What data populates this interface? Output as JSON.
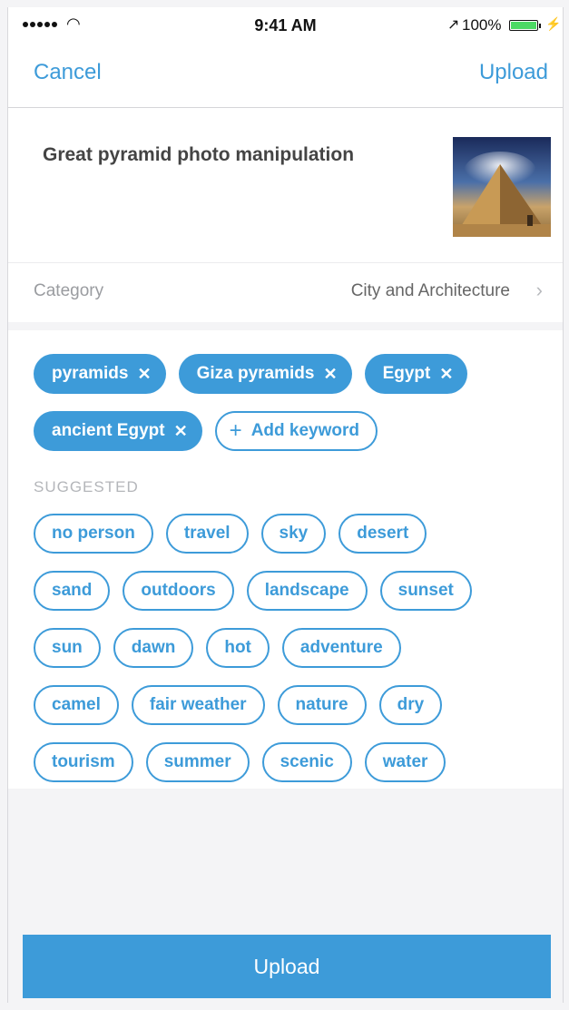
{
  "status_bar": {
    "time": "9:41 AM",
    "battery": "100%",
    "icons": [
      "signal-dots-icon",
      "wifi-icon",
      "location-arrow-icon",
      "battery-icon",
      "charging-bolt-icon"
    ]
  },
  "nav": {
    "cancel_label": "Cancel",
    "upload_label": "Upload"
  },
  "photo": {
    "title": "Great pyramid photo manipulation"
  },
  "category": {
    "label": "Category",
    "value": "City and Architecture",
    "chevron_icon": "chevron-right-icon"
  },
  "keywords": {
    "selected": [
      "pyramids",
      "Giza pyramids",
      "Egypt",
      "ancient Egypt"
    ],
    "remove_icon": "close-x-icon",
    "add_label": "Add keyword",
    "add_icon": "plus-icon"
  },
  "suggested": {
    "header": "SUGGESTED",
    "rows": [
      [
        "no person",
        "travel",
        "sky",
        "desert"
      ],
      [
        "sand",
        "outdoors",
        "landscape",
        "sunset"
      ],
      [
        "sun",
        "dawn",
        "hot",
        "adventure"
      ],
      [
        "camel",
        "fair weather",
        "nature",
        "dry"
      ],
      [
        "tourism",
        "summer",
        "scenic",
        "water"
      ]
    ]
  },
  "footer": {
    "upload_label": "Upload"
  },
  "colors": {
    "accent": "#3d9bd9",
    "background": "#f4f4f6",
    "muted_text": "#9a9ca0"
  }
}
